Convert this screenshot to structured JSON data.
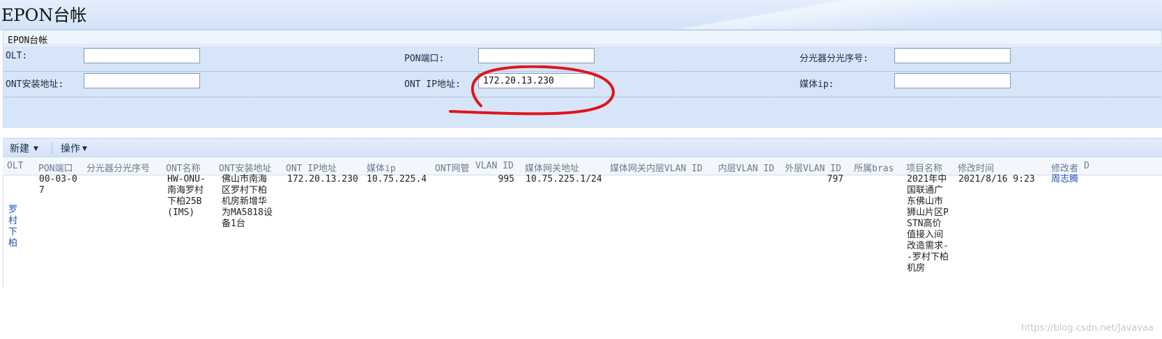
{
  "app": {
    "title": "EPON台帐"
  },
  "panel": {
    "title": "EPON台帐"
  },
  "form": {
    "olt_label": "OLT:",
    "olt_value": "",
    "pon_label": "PON端口:",
    "pon_value": "",
    "splitter_label": "分光器分光序号:",
    "splitter_value": "",
    "ont_address_label": "ONT安装地址:",
    "ont_address_value": "",
    "ont_ip_label": "ONT IP地址:",
    "ont_ip_value": "172.20.13.230",
    "media_ip_label": "媒体ip:",
    "media_ip_value": ""
  },
  "annotation": {
    "color": "#e0141c"
  },
  "toolbar": {
    "new_label": "新建",
    "operate_label": "操作"
  },
  "table": {
    "columns": [
      "OLT",
      "PON端口",
      "分光器分光序号",
      "ONT名称",
      "ONT安装地址",
      "ONT IP地址",
      "媒体ip",
      "ONT网管",
      "VLAN ID",
      "媒体网关地址",
      "媒体网关内层VLAN ID",
      "内层VLAN ID",
      "外层VLAN ID",
      "所属bras",
      "项目名称",
      "修改时间",
      "修改者",
      "D"
    ],
    "rows": [
      {
        "olt": "罗村下柏",
        "pon": "00-03-07",
        "splitter": "",
        "ont_name": "HW-ONU-南海罗村下柏25B(IMS)",
        "ont_address": "佛山市南海区罗村下柏机房新增华为MA5818设备1台",
        "ont_ip": "172.20.13.230",
        "media_ip": "10.75.225.4",
        "ont_nms": "",
        "vlan_id": "995",
        "gateway": "10.75.225.1/24",
        "gw_inner_vlan": "",
        "inner_vlan": "",
        "outer_vlan": "797",
        "bras": "",
        "project": "2021年中国联通广东佛山市狮山片区PSTN高价值接入间改造需求--罗村下柏机房",
        "modified_time": "2021/8/16 9:23",
        "modifier": "周志腾"
      }
    ]
  },
  "watermark": "https://blog.csdn.net/Javavaa"
}
